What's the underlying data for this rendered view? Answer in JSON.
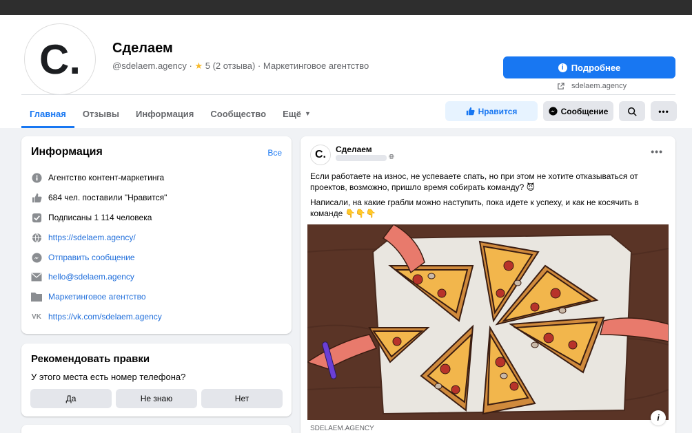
{
  "page": {
    "name": "Сделаем",
    "avatar_letter": "C.",
    "handle": "@sdelaem.agency",
    "rating_value": "5",
    "rating_reviews": "(2 отзыва)",
    "category": "Маркетинговое агентство",
    "more_button": "Подробнее",
    "site": "sdelaem.agency"
  },
  "tabs": [
    {
      "label": "Главная",
      "active": true
    },
    {
      "label": "Отзывы"
    },
    {
      "label": "Информация"
    },
    {
      "label": "Сообщество"
    },
    {
      "label": "Ещё"
    }
  ],
  "actions": {
    "like": "Нравится",
    "message": "Сообщение"
  },
  "info": {
    "title": "Информация",
    "all": "Все",
    "rows": [
      {
        "icon": "info-icon",
        "text": "Агентство контент-маркетинга"
      },
      {
        "icon": "thumbs-up-icon",
        "text": "684 чел. поставили \"Нравится\""
      },
      {
        "icon": "check-icon",
        "text": "Подписаны 1 114 человека"
      },
      {
        "icon": "globe-icon",
        "text": "https://sdelaem.agency/"
      },
      {
        "icon": "messenger-icon",
        "text": "Отправить сообщение"
      },
      {
        "icon": "mail-icon",
        "text": "hello@sdelaem.agency"
      },
      {
        "icon": "folder-icon",
        "text": "Маркетинговое агентство"
      },
      {
        "icon": "vk-icon",
        "text": "https://vk.com/sdelaem.agency"
      }
    ]
  },
  "recommend": {
    "title": "Рекомендовать правки",
    "question": "У этого места есть номер телефона?",
    "yes": "Да",
    "unknown": "Не знаю",
    "no": "Нет"
  },
  "post": {
    "author": "Сделаем",
    "avatar_letter": "C.",
    "text1": "Если работаете на износ, не успеваете спать, но при этом не хотите отказываться от проектов, возможно, пришло время собирать команду? 😈",
    "text2": "Написали, на какие грабли можно наступить, пока идете к успеху, и как не косячить в команде 👇👇👇",
    "source": "SDELAEM.AGENCY"
  },
  "colors": {
    "accent": "#1877f2",
    "topbar": "#2e2e2e",
    "table": "#5a3426",
    "pizza_crust": "#d08a3c"
  }
}
